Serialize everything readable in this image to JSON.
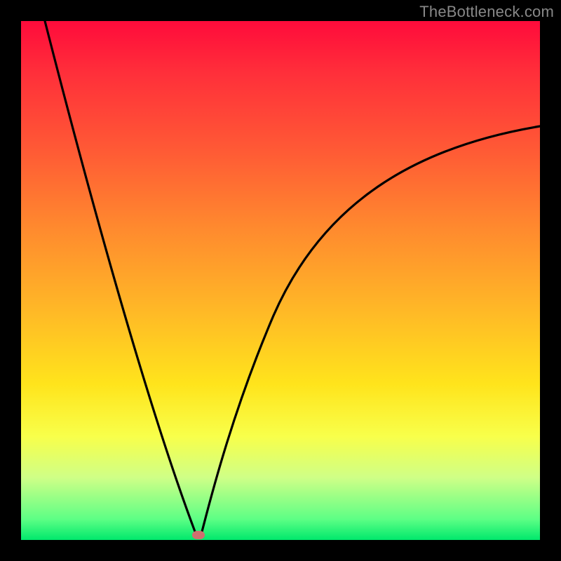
{
  "watermark": "TheBottleneck.com",
  "colors": {
    "frame": "#000000",
    "curve": "#000000",
    "marker": "#cf6f6f",
    "gradient_stops": [
      "#ff0b3b",
      "#ff2f3a",
      "#ff5a35",
      "#ff8a2e",
      "#ffb627",
      "#ffe41c",
      "#f8ff4a",
      "#cfff87",
      "#5dff85",
      "#00e86c"
    ]
  },
  "chart_data": {
    "type": "line",
    "title": "",
    "xlabel": "",
    "ylabel": "",
    "x_range": [
      0,
      100
    ],
    "y_range": [
      0,
      100
    ],
    "min_point": {
      "x": 34,
      "y": 0
    },
    "series": [
      {
        "name": "bottleneck-curve",
        "x": [
          0,
          4,
          8,
          12,
          16,
          20,
          24,
          27,
          30,
          32,
          33,
          34,
          35,
          36,
          38,
          41,
          45,
          50,
          56,
          63,
          72,
          82,
          92,
          100
        ],
        "y": [
          100,
          88,
          76,
          65,
          54,
          43,
          32,
          22,
          12,
          5,
          2,
          0,
          3,
          7,
          14,
          24,
          35,
          45,
          54,
          62,
          69,
          74,
          78,
          80
        ]
      }
    ],
    "marker": {
      "x": 34,
      "y": 0
    }
  }
}
